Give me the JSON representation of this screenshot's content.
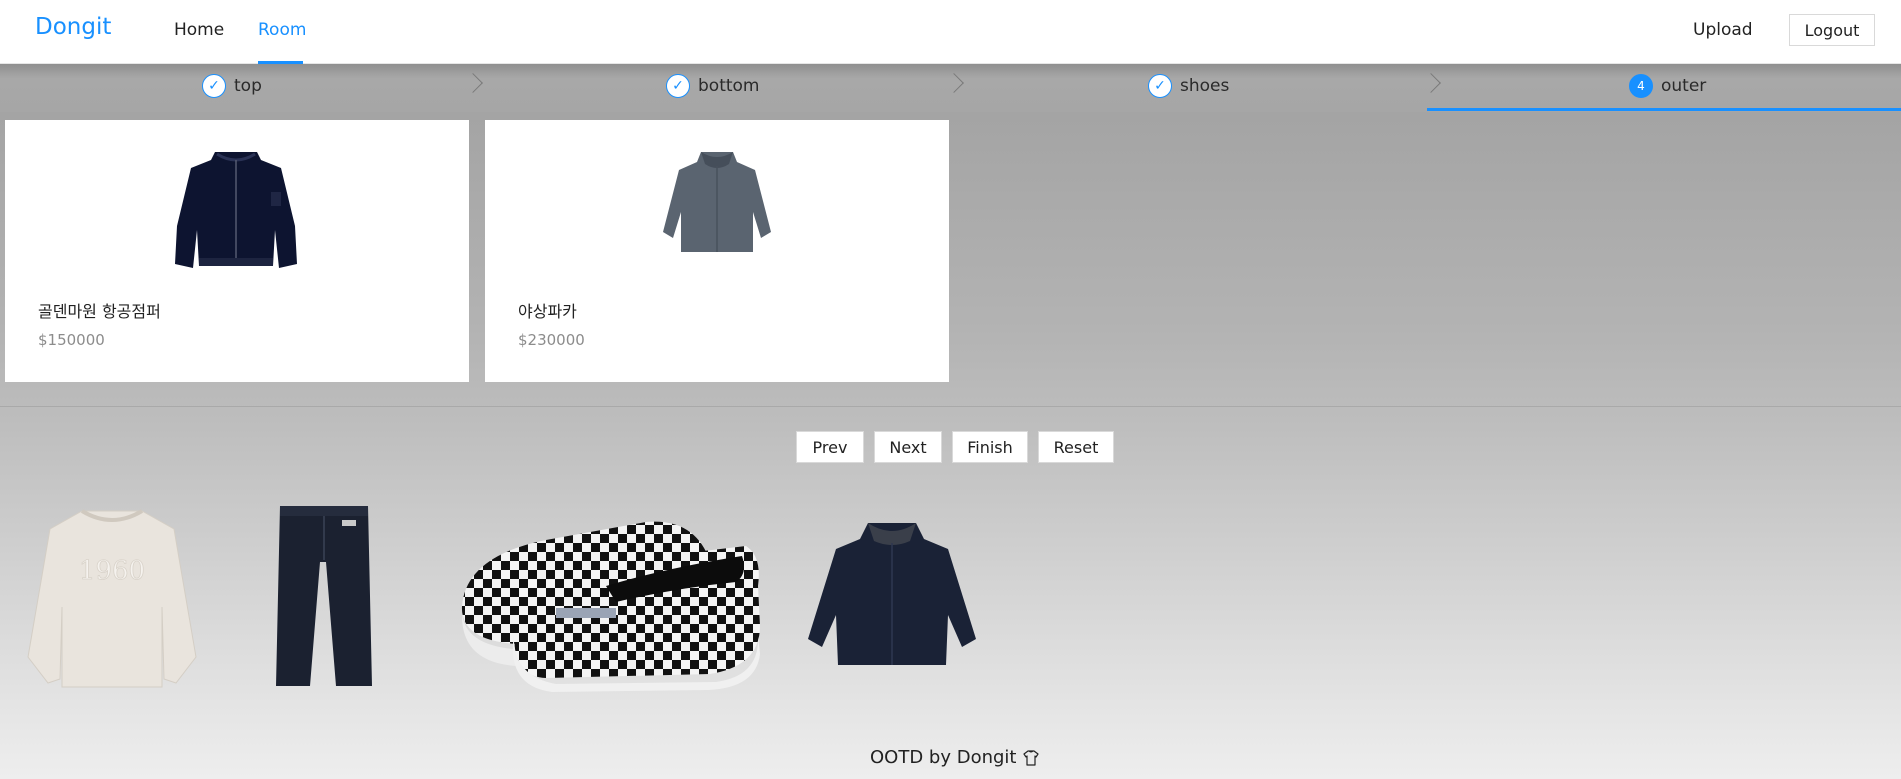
{
  "header": {
    "logo": "Dongit",
    "nav": {
      "home": "Home",
      "room": "Room"
    },
    "upload": "Upload",
    "logout": "Logout"
  },
  "steps": [
    {
      "label": "top",
      "status": "done"
    },
    {
      "label": "bottom",
      "status": "done"
    },
    {
      "label": "shoes",
      "status": "done"
    },
    {
      "label": "outer",
      "status": "active",
      "number": "4"
    }
  ],
  "products": [
    {
      "name": "골덴마원 항공점퍼",
      "price": "$150000",
      "icon": "navy-bomber-jacket"
    },
    {
      "name": "야상파카",
      "price": "$230000",
      "icon": "grey-parka"
    }
  ],
  "actions": {
    "prev": "Prev",
    "next": "Next",
    "finish": "Finish",
    "reset": "Reset"
  },
  "outfit": [
    {
      "icon": "sweatshirt-1960",
      "print": "1960"
    },
    {
      "icon": "denim-jeans"
    },
    {
      "icon": "checkered-slip-on-shoes"
    },
    {
      "icon": "navy-parka"
    }
  ],
  "footer": {
    "text": "OOTD by Dongit"
  },
  "colors": {
    "accent": "#1890ff"
  }
}
